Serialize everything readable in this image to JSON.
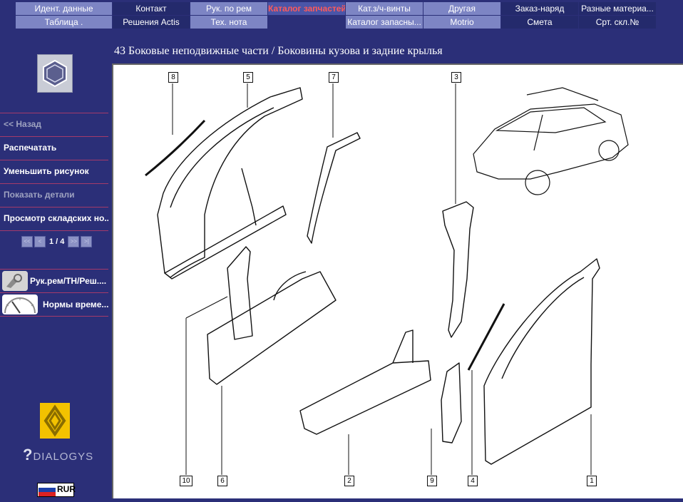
{
  "nav": {
    "tabs_row1": [
      {
        "label": "Идент. данные",
        "style": "light"
      },
      {
        "label": "Контакт",
        "style": "dark"
      },
      {
        "label": "Рук. по рем",
        "style": "light"
      },
      {
        "label": "Каталог запчастей",
        "style": "active"
      },
      {
        "label": "Кат.з/ч-винты",
        "style": "light"
      },
      {
        "label": "Другая",
        "style": "light"
      },
      {
        "label": "Заказ-наряд",
        "style": "dark"
      },
      {
        "label": "Разные материа...",
        "style": "dark"
      }
    ],
    "tabs_row2": [
      {
        "label": "Таблица .",
        "style": "light"
      },
      {
        "label": "Решения Actis",
        "style": "dark"
      },
      {
        "label": "Тех. нота",
        "style": "light"
      },
      {
        "label": "Каталог запасны...",
        "style": "light"
      },
      {
        "label": "Motrio",
        "style": "light"
      },
      {
        "label": "Смета",
        "style": "dark"
      },
      {
        "label": "Срт. скл.№",
        "style": "dark"
      }
    ]
  },
  "sidebar": {
    "back": "<< Назад",
    "print": "Распечатать",
    "shrink": "Уменьшить рисунок",
    "show_details": "Показать детали",
    "stock_view": "Просмотр складских но...",
    "pager": {
      "text": "1 / 4",
      "first": "<<",
      "prev": "<",
      "next": ">>",
      "last": ">|"
    },
    "tools": [
      {
        "label": "Рук.рем/ТН/Реш....",
        "icon": "repair-manual-icon"
      },
      {
        "label": "Нормы време...",
        "icon": "time-norms-icon"
      }
    ],
    "logo_text": "DIALOGYS",
    "currency": "RUR"
  },
  "page_title": "43 Боковые неподвижные части / Боковины кузова и задние крылья",
  "diagram": {
    "callouts": [
      "8",
      "5",
      "7",
      "3",
      "10",
      "6",
      "2",
      "9",
      "4",
      "1"
    ]
  },
  "colors": {
    "background": "#2b2f78",
    "active_tab_text": "#ff5a5a",
    "separator": "#a43a6a"
  }
}
